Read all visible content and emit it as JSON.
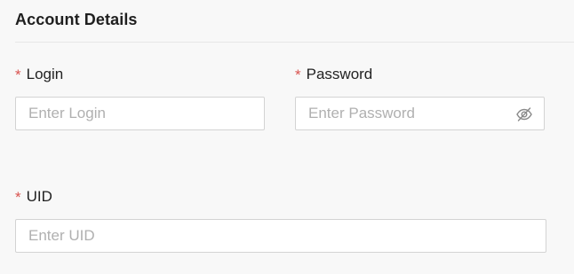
{
  "section": {
    "title": "Account Details"
  },
  "fields": {
    "login": {
      "required_mark": "*",
      "label": "Login",
      "placeholder": "Enter Login",
      "value": ""
    },
    "password": {
      "required_mark": "*",
      "label": "Password",
      "placeholder": "Enter Password",
      "value": "",
      "toggle_icon": "eye-slash-icon"
    },
    "uid": {
      "required_mark": "*",
      "label": "UID",
      "placeholder": "Enter UID",
      "value": ""
    }
  },
  "colors": {
    "required": "#d9534f",
    "background": "#f8f8f8",
    "input_border": "#d3d3d3",
    "placeholder": "#b0b0b0"
  }
}
